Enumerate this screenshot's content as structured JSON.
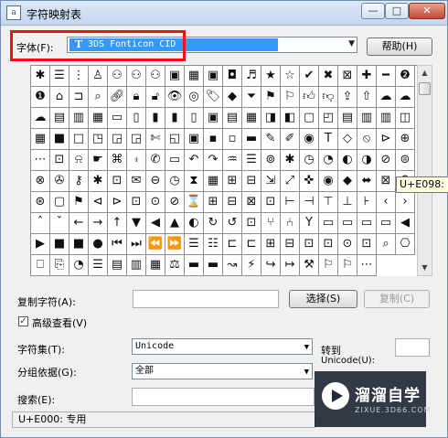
{
  "window": {
    "title": "字符映射表",
    "icon_glyph": "a",
    "min": "—",
    "max": "□",
    "close": "✕"
  },
  "font_row": {
    "label": "字体(F):",
    "selected": "3DS Fonticon CID",
    "help_button": "帮助(H)"
  },
  "grid_glyphs": [
    "✱",
    "☰",
    "⋮",
    "♙",
    "⚇",
    "⚇",
    "⚇",
    "▣",
    "▦",
    "▣",
    "◘",
    "♬",
    "★",
    "☆",
    "✔",
    "✖",
    "⊠",
    "✚",
    "━",
    "❷",
    "❶",
    "⌂",
    "⊐",
    "⌕",
    "🔗︎",
    "🔒︎",
    "🔓︎",
    "👁︎",
    "◎",
    "🏷︎",
    "◆",
    "⏷",
    "⚑",
    "⚐",
    "👍︎",
    "👎︎",
    "⇪",
    "⇧",
    "☁",
    "☁",
    "☁",
    "▤",
    "▥",
    "▦",
    "▭",
    "▯",
    "▮",
    "▮",
    "▯",
    "▣",
    "▤",
    "▦",
    "◨",
    "◧",
    "▢",
    "◰",
    "▤",
    "▥",
    "▥",
    "◫",
    "▦",
    "■",
    "□",
    "◳",
    "◲",
    "◲",
    "✄",
    "◱",
    "▣",
    "▪",
    "▫",
    "▬",
    "✎",
    "✐",
    "◉",
    "T",
    "◇",
    "⦸",
    "⊳",
    "⊕",
    "⋯",
    "⊡",
    "⍾",
    "☛",
    "⌘",
    "⍖",
    "✆",
    "▭",
    "↶",
    "↷",
    "♒",
    "☰",
    "⊚",
    "✱",
    "◷",
    "◔",
    "◐",
    "◑",
    "⊘",
    "⊜",
    "⊗",
    "✇",
    "⚷",
    "✱",
    "⊡",
    "✉",
    "⊖",
    "◷",
    "⧗",
    "▦",
    "⊞",
    "⊟",
    "⇲",
    "⤢",
    "✜",
    "◉",
    "◆",
    "⬌",
    "⊠",
    "♀",
    "⊛",
    "▢",
    "⚑",
    "⊲",
    "⊳",
    "⊡",
    "⊙",
    "⊘",
    "⌛",
    "⊞",
    "⊟",
    "⊠",
    "⊡",
    "⊢",
    "⊣",
    "⊤",
    "⊥",
    "⊦",
    "‹",
    "›",
    "ˆ",
    "ˇ",
    "←",
    "→",
    "↑",
    "▼",
    "◀",
    "▲",
    "◐",
    "↻",
    "↺",
    "⊡",
    "⑂",
    "⑃",
    "Y",
    "▭",
    "▭",
    "▭",
    "▭",
    "◀",
    "▶",
    "■",
    "■",
    "●",
    "⏮",
    "⏭",
    "⏪",
    "⏩",
    "☰",
    "☷",
    "⊏",
    "⊏",
    "⊞",
    "⊟",
    "⊡",
    "⊡",
    "⊙",
    "⊡",
    "⌕",
    "⎔",
    "⎕",
    "⎘",
    "◔",
    "☰",
    "▤",
    "▥",
    "▦",
    "⚖",
    "▬",
    "▬",
    "↝",
    "⚡",
    "↪",
    "↦",
    "⚒",
    "⚐",
    "⚐",
    "⋯"
  ],
  "tooltip": "U+E098: ...",
  "copy_row": {
    "label": "复制字符(A):",
    "value": "",
    "select_button": "选择(S)",
    "copy_button": "复制(C)"
  },
  "advanced": {
    "label": "高级查看(V)",
    "checked": "✓"
  },
  "charset": {
    "label": "字符集(T):",
    "value": "Unicode",
    "goto_label": "转到",
    "unicode_label": "Unicode(U):",
    "unicode_value": ""
  },
  "group_by": {
    "label": "分组依据(G):",
    "value": "全部"
  },
  "search": {
    "label": "搜索(E):",
    "value": ""
  },
  "status": "U+E000: 专用",
  "watermark": {
    "text": "溜溜自学",
    "sub": "ZIXUE.3D66.COM"
  },
  "colors": {
    "highlight": "#3399ff",
    "annotation": "#e8141c",
    "window_border": "#6f8fb3"
  }
}
